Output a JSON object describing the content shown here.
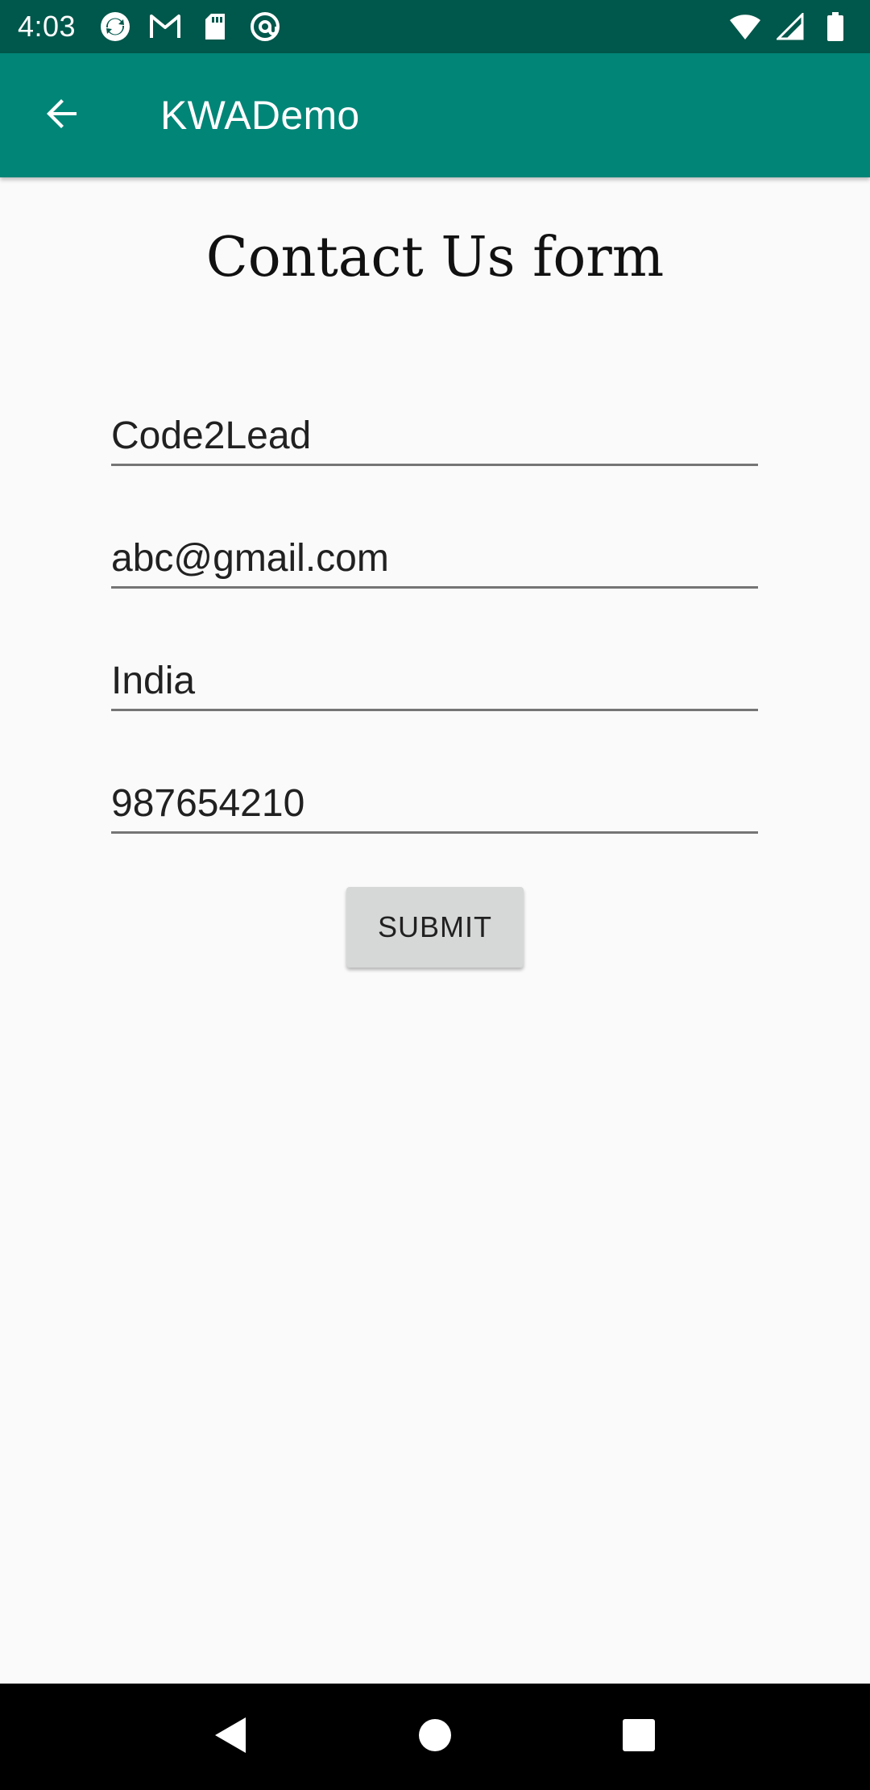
{
  "status_bar": {
    "time": "4:03",
    "left_icons": [
      "sync-icon",
      "gmail-icon",
      "sd-card-icon",
      "at-sign-icon"
    ],
    "right_icons": [
      "wifi-icon",
      "cell-signal-icon",
      "battery-icon"
    ]
  },
  "app_bar": {
    "title": "KWADemo",
    "background_color": "#008577"
  },
  "form": {
    "title": "Contact Us form",
    "fields": {
      "name": "Code2Lead",
      "email": "abc@gmail.com",
      "country": "India",
      "phone": "987654210"
    },
    "submit_label": "SUBMIT"
  },
  "nav_bar": {
    "icons": [
      "back-icon",
      "home-icon",
      "recents-icon"
    ]
  }
}
